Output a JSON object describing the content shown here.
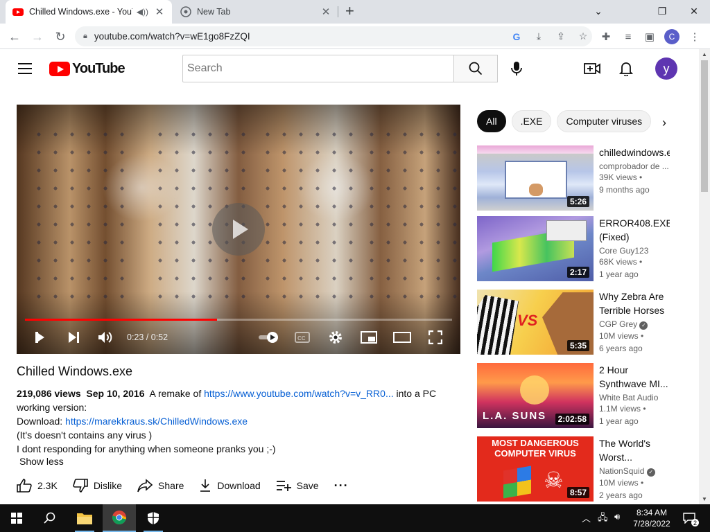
{
  "browser": {
    "tabs": [
      {
        "title": "Chilled Windows.exe - YouTu",
        "active": true
      },
      {
        "title": "New Tab",
        "active": false
      }
    ],
    "new_tab_symbol": "+",
    "url": "youtube.com/watch?v=wE1go8FzZQI",
    "profile_initial": "C"
  },
  "youtube": {
    "logo_text": "YouTube",
    "search_placeholder": "Search",
    "avatar_initial": "y"
  },
  "player": {
    "time": "0:23 / 0:52",
    "progress_fraction": 0.45
  },
  "video": {
    "title": "Chilled Windows.exe",
    "views": "219,086 views",
    "date": "Sep 10, 2016",
    "desc_prefix": "A remake of",
    "desc_link1": "https://www.youtube.com/watch?v=v_RR0...",
    "desc_suffix": "into a PC working version:",
    "download_label": "Download:",
    "desc_link2": "https://marekkraus.sk/ChilledWindows.exe",
    "line3": "(It's doesn't contains any virus )",
    "line4": "I dont responding for anything when someone pranks you ;-)",
    "show_less": "Show less",
    "actions": {
      "likes": "2.3K",
      "dislike": "Dislike",
      "share": "Share",
      "download": "Download",
      "save": "Save"
    }
  },
  "chips": [
    "All",
    ".EXE",
    "Computer viruses"
  ],
  "recommendations": [
    {
      "title": "chilledwindows.exe",
      "channel": "comprobador de ...",
      "views": "39K views",
      "age": "9 months ago",
      "duration": "5:26"
    },
    {
      "title": "ERROR408.EXE (Fixed)",
      "channel": "Core Guy123",
      "views": "68K views",
      "age": "1 year ago",
      "duration": "2:17"
    },
    {
      "title": "Why Zebra Are Terrible Horses",
      "channel": "CGP Grey",
      "views": "10M views",
      "age": "6 years ago",
      "duration": "5:35",
      "thumb_text": "VS"
    },
    {
      "title": "2 Hour Synthwave MI...",
      "channel": "White Bat Audio",
      "views": "1.1M views",
      "age": "1 year ago",
      "duration": "2:02:58",
      "thumb_text": "L.A. SUNS"
    },
    {
      "title": "The World's Worst...",
      "channel": "NationSquid",
      "views": "10M views",
      "age": "2 years ago",
      "duration": "8:57",
      "thumb_text": "MOST DANGEROUS COMPUTER VIRUS"
    }
  ],
  "taskbar": {
    "time": "8:34 AM",
    "date": "7/28/2022",
    "notification_count": "2"
  }
}
